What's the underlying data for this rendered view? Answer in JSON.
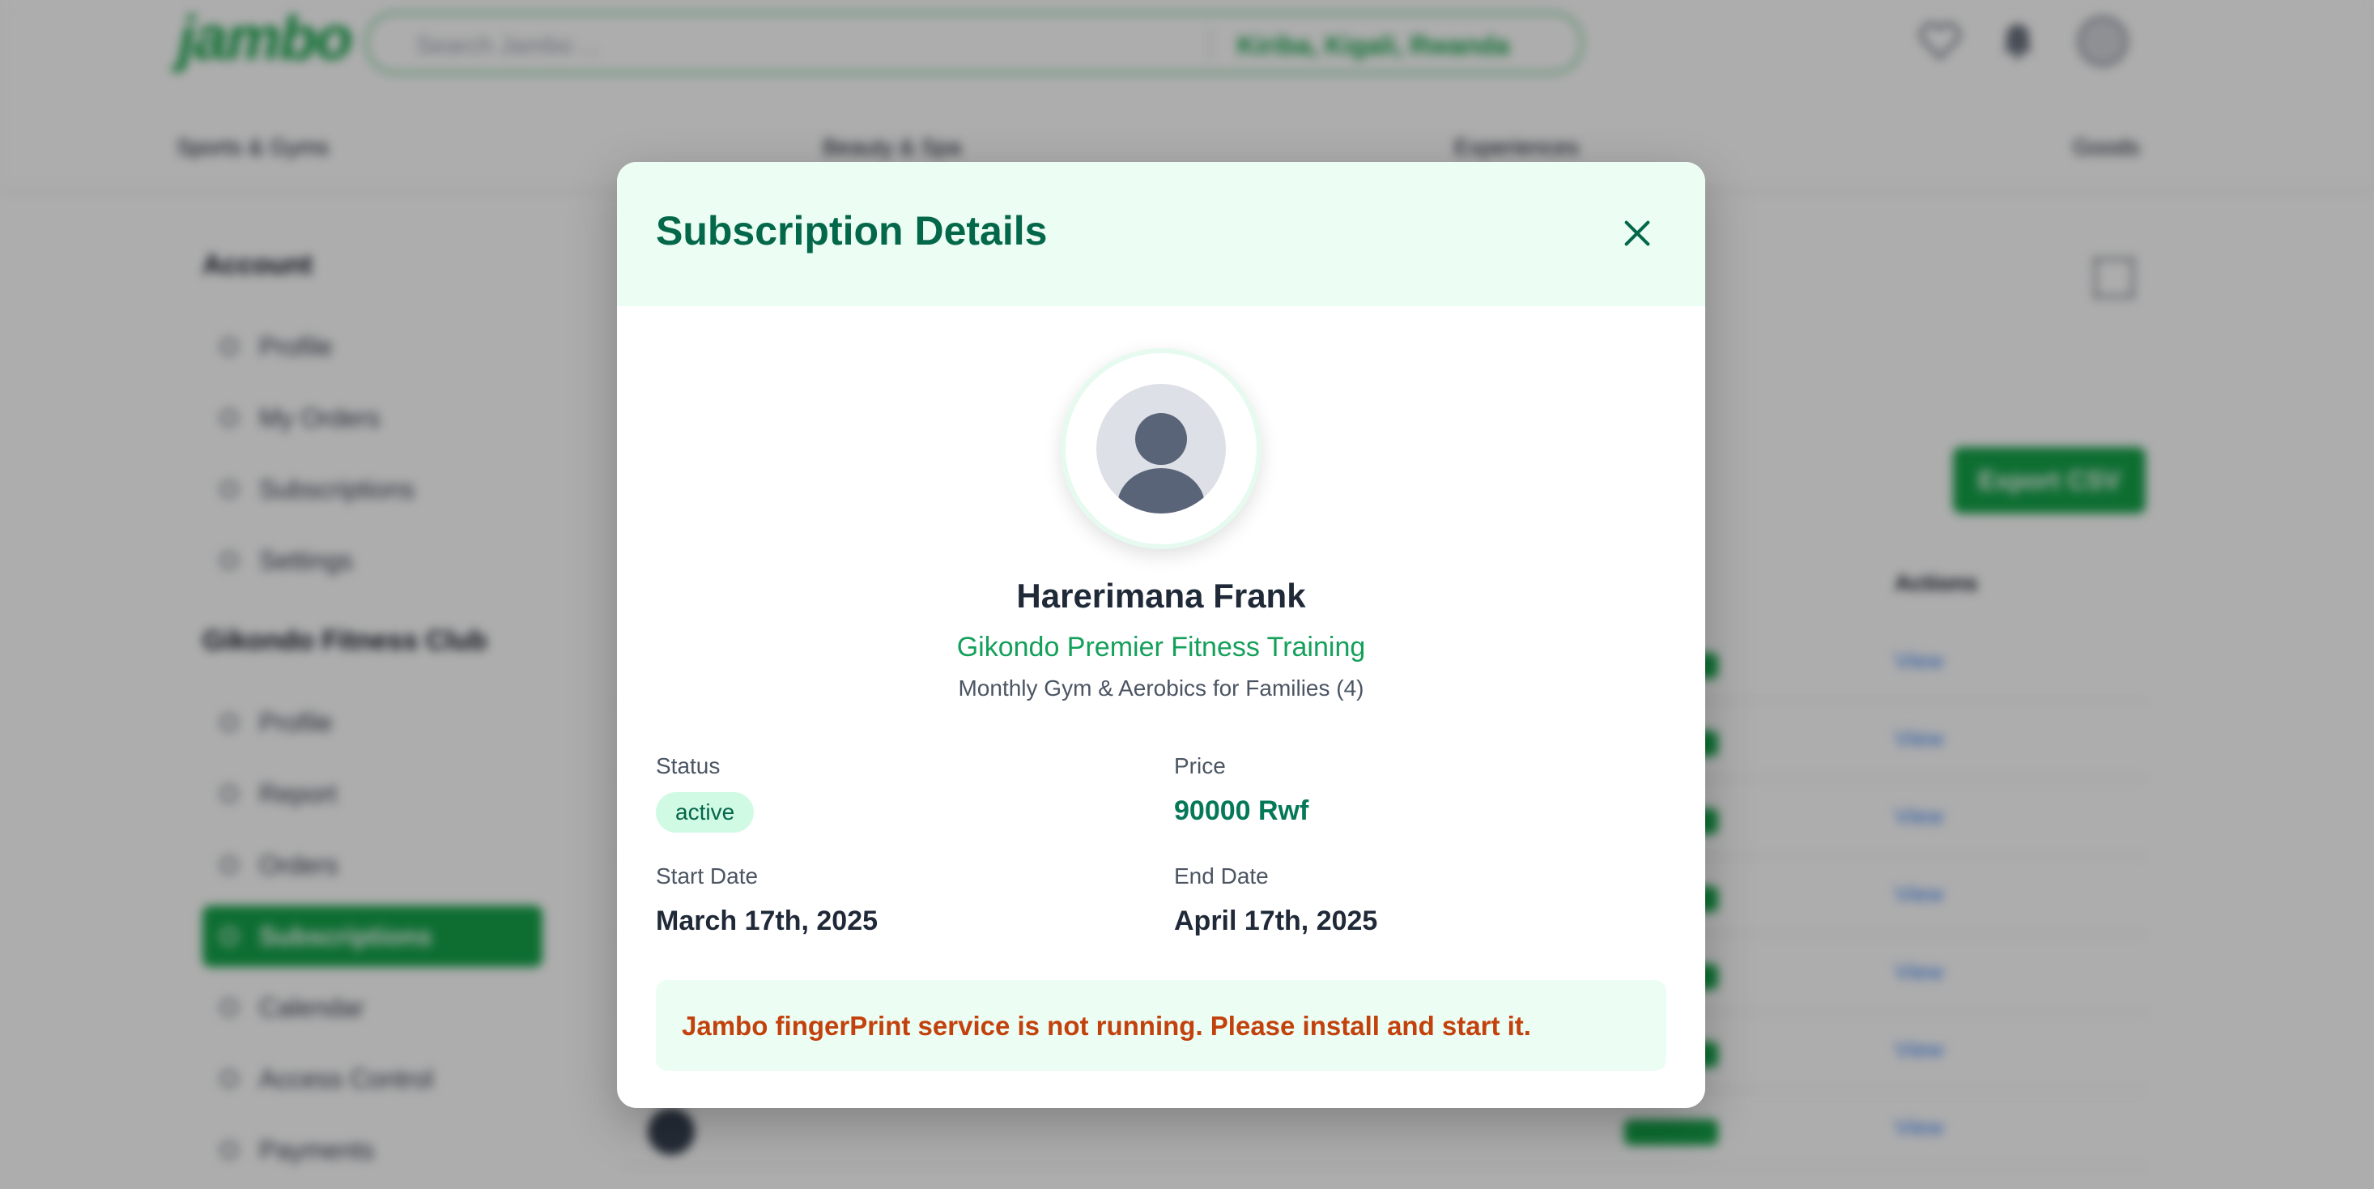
{
  "header": {
    "logo": "jambo",
    "search_placeholder": "Search Jambo ...",
    "location": "Kiriba, Kigali, Rwanda"
  },
  "categories": [
    "Sports & Gyms",
    "Beauty & Spa",
    "Experiences",
    "Goods"
  ],
  "sidebar": {
    "account_heading": "Account",
    "account_items": [
      "Profile",
      "My Orders",
      "Subscriptions",
      "Settings"
    ],
    "business_heading": "Gikondo Fitness Club",
    "business_items": [
      "Profile",
      "Report",
      "Orders",
      "Subscriptions",
      "Calendar",
      "Access Control",
      "Payments"
    ],
    "active_item": "Subscriptions"
  },
  "table": {
    "export_label": "Export CSV",
    "actions_header": "Actions",
    "view_label": "View"
  },
  "modal": {
    "title": "Subscription Details",
    "member_name": "Harerimana Frank",
    "gym_name": "Gikondo Premier Fitness Training",
    "plan_name": "Monthly Gym & Aerobics for Families (4)",
    "status_label": "Status",
    "status_value": "active",
    "price_label": "Price",
    "price_value": "90000 Rwf",
    "start_label": "Start Date",
    "start_value": "March 17th, 2025",
    "end_label": "End Date",
    "end_value": "April 17th, 2025",
    "alert": "Jambo fingerPrint service is not running. Please install and start it."
  },
  "colors": {
    "brand_green": "#15a34a",
    "title_green": "#03674a",
    "alert_orange": "#c2410c",
    "modal_header_bg": "#ecfdf3"
  },
  "icons": {
    "close": "close-icon",
    "avatar": "user-silhouette-icon",
    "heart": "heart-icon",
    "bell": "bell-icon"
  }
}
